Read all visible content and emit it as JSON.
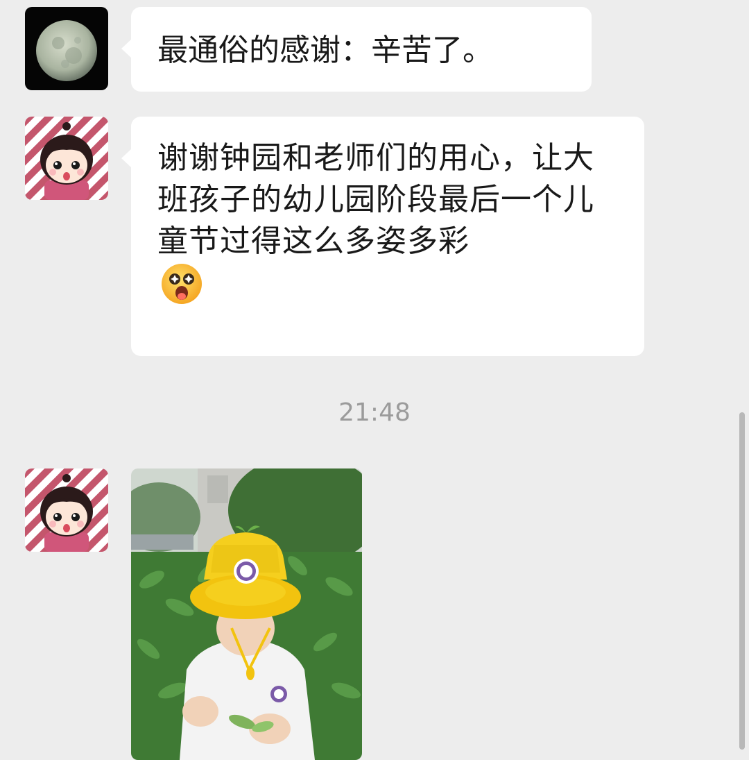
{
  "messages": [
    {
      "sender": "moon-avatar",
      "text": "最通俗的感谢：辛苦了。"
    },
    {
      "sender": "girl-avatar",
      "text": "谢谢钟园和老师们的用心，让大班孩子的幼儿园阶段最后一个儿童节过得这么多姿多彩",
      "emoji": "star-eyes-emoji"
    },
    {
      "sender": "girl-avatar",
      "type": "image",
      "icon": "photo-child-yellow-hat"
    }
  ],
  "timestamp": "21:48",
  "colors": {
    "background": "#ededed",
    "bubble": "#ffffff",
    "text": "#191919",
    "timestamp": "#9b9b9b"
  }
}
